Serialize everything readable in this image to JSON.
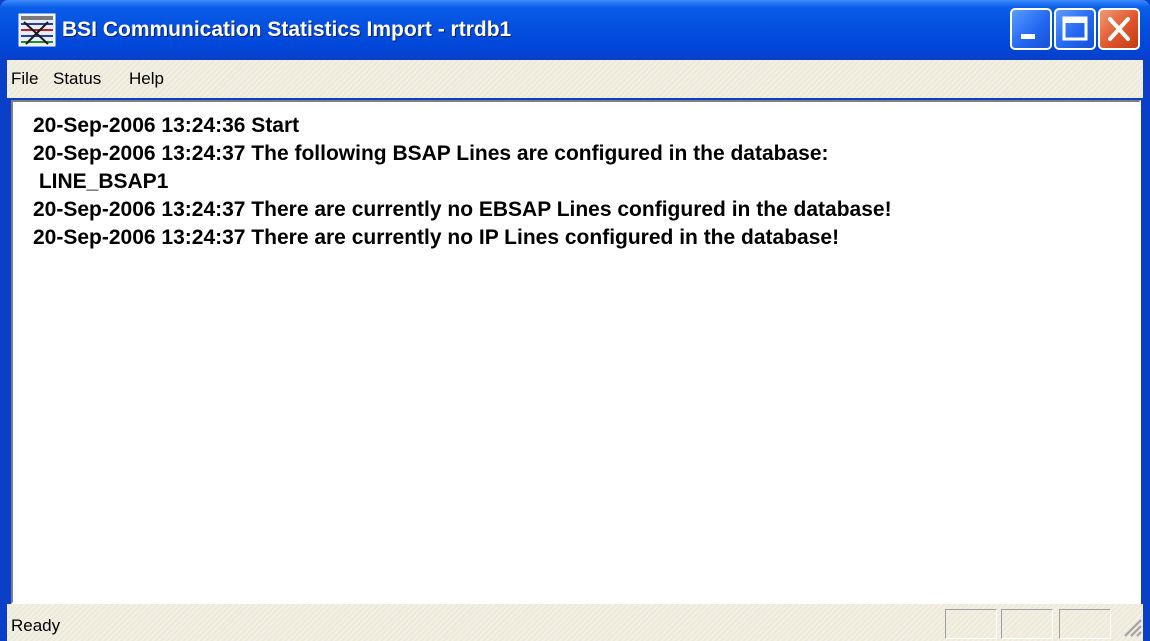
{
  "window": {
    "title": "BSI Communication Statistics Import - rtrdb1",
    "app_icon": "bsi-network-icon",
    "controls": {
      "minimize": "minimize-icon",
      "maximize": "maximize-icon",
      "close": "close-icon"
    }
  },
  "menu": [
    {
      "label": "File"
    },
    {
      "label": "Status"
    },
    {
      "label": "Help"
    }
  ],
  "log": [
    {
      "text": "20-Sep-2006 13:24:36  Start"
    },
    {
      "text": "20-Sep-2006 13:24:37  The following BSAP Lines are configured in the database:"
    },
    {
      "text": " LINE_BSAP1"
    },
    {
      "text": "20-Sep-2006 13:24:37  There are currently no EBSAP Lines configured in the database!"
    },
    {
      "text": "20-Sep-2006 13:24:37  There are currently no IP Lines configured in the database!"
    }
  ],
  "status": {
    "text": "Ready"
  },
  "colors": {
    "titlebar": "#0551e0",
    "close_button": "#e0552c",
    "face": "#ece9d8"
  }
}
